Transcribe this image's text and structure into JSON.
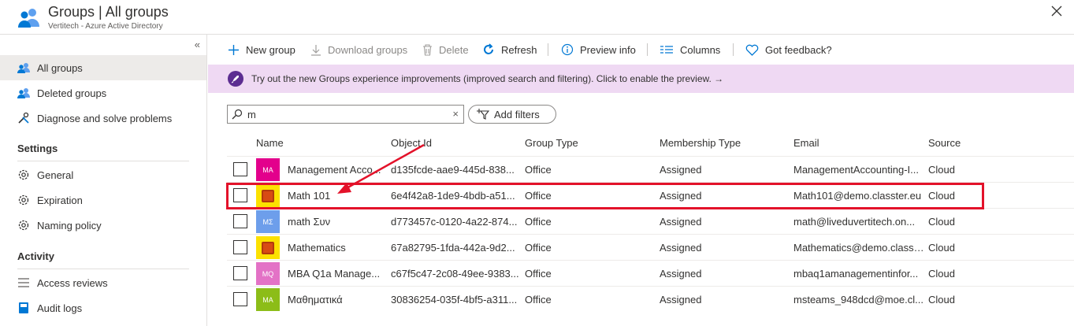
{
  "header": {
    "title": "Groups | All groups",
    "subtitle": "Vertitech - Azure Active Directory"
  },
  "sidebar": {
    "collapse_glyph": "«",
    "items": [
      {
        "label": "All groups",
        "icon": "group-icon"
      },
      {
        "label": "Deleted groups",
        "icon": "group-icon"
      },
      {
        "label": "Diagnose and solve problems",
        "icon": "wrench-icon"
      }
    ],
    "settings": {
      "heading": "Settings",
      "items": [
        {
          "label": "General",
          "icon": "gear-icon"
        },
        {
          "label": "Expiration",
          "icon": "gear-icon"
        },
        {
          "label": "Naming policy",
          "icon": "gear-icon"
        }
      ]
    },
    "activity": {
      "heading": "Activity",
      "items": [
        {
          "label": "Access reviews",
          "icon": "list-icon"
        },
        {
          "label": "Audit logs",
          "icon": "book-icon"
        }
      ]
    }
  },
  "toolbar": {
    "new_group": "New group",
    "download_groups": "Download groups",
    "delete": "Delete",
    "refresh": "Refresh",
    "preview_info": "Preview info",
    "columns": "Columns",
    "feedback": "Got feedback?"
  },
  "banner": {
    "text": "Try out the new Groups experience improvements (improved search and filtering). Click to enable the preview. →"
  },
  "search": {
    "value": "m",
    "clear_glyph": "×"
  },
  "filters": {
    "label": "Add filters"
  },
  "table": {
    "headers": {
      "name": "Name",
      "object_id": "Object Id",
      "group_type": "Group Type",
      "membership_type": "Membership Type",
      "email": "Email",
      "source": "Source"
    },
    "rows": [
      {
        "initials": "MA",
        "avatar_color": "#e3008c",
        "name": "Management Acco...",
        "object_id": "d135fcde-aae9-445d-838...",
        "group_type": "Office",
        "membership_type": "Assigned",
        "email": "ManagementAccounting-I...",
        "source": "Cloud"
      },
      {
        "initials": "",
        "avatar_color": "#fce100",
        "name": "Math 101",
        "object_id": "6e4f42a8-1de9-4bdb-a51...",
        "group_type": "Office",
        "membership_type": "Assigned",
        "email": "Math101@demo.classter.eu",
        "source": "Cloud"
      },
      {
        "initials": "ΜΣ",
        "avatar_color": "#6d9eeb",
        "name": "math Συν",
        "object_id": "d773457c-0120-4a22-874...",
        "group_type": "Office",
        "membership_type": "Assigned",
        "email": "math@liveduvertitech.on...",
        "source": "Cloud"
      },
      {
        "initials": "",
        "avatar_color": "#fce100",
        "name": "Mathematics",
        "object_id": "67a82795-1fda-442a-9d2...",
        "group_type": "Office",
        "membership_type": "Assigned",
        "email": "Mathematics@demo.classt...",
        "source": "Cloud"
      },
      {
        "initials": "MQ",
        "avatar_color": "#e372c6",
        "name": "MBA Q1a Manage...",
        "object_id": "c67f5c47-2c08-49ee-9383...",
        "group_type": "Office",
        "membership_type": "Assigned",
        "email": "mbaq1amanagementinfor...",
        "source": "Cloud"
      },
      {
        "initials": "ΜΑ",
        "avatar_color": "#8cbd18",
        "name": "Μαθηματικά",
        "object_id": "30836254-035f-4bf5-a311...",
        "group_type": "Office",
        "membership_type": "Assigned",
        "email": "msteams_948dcd@moe.cl...",
        "source": "Cloud"
      }
    ]
  },
  "colors": {
    "accent": "#0078d4",
    "highlight": "#e3122a",
    "banner_bg": "#efd9f3"
  }
}
